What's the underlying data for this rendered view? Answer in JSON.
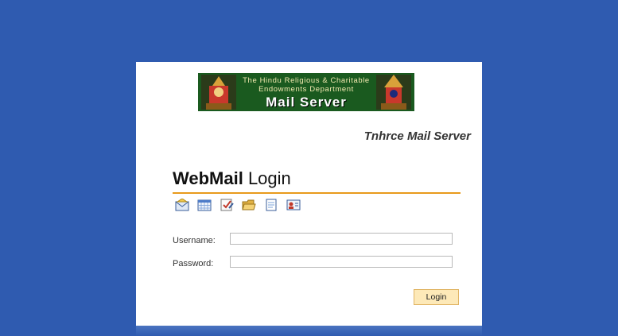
{
  "banner": {
    "line1": "The Hindu Religious & Charitable",
    "line2": "Endowments Department",
    "title": "Mail Server"
  },
  "server_title": "Tnhrce Mail Server",
  "heading": {
    "bold": "WebMail",
    "rest": " Login"
  },
  "toolbar_icons": [
    "mail-icon",
    "calendar-icon",
    "tasks-icon",
    "folders-icon",
    "notes-icon",
    "contacts-icon"
  ],
  "form": {
    "username_label": "Username:",
    "username_value": "",
    "password_label": "Password:",
    "password_value": "",
    "login_label": "Login"
  },
  "colors": {
    "background": "#2f5bb0",
    "accent_rule": "#e89a1c",
    "button_bg": "#fde9b8",
    "banner_bg": "#1a5a1f"
  }
}
